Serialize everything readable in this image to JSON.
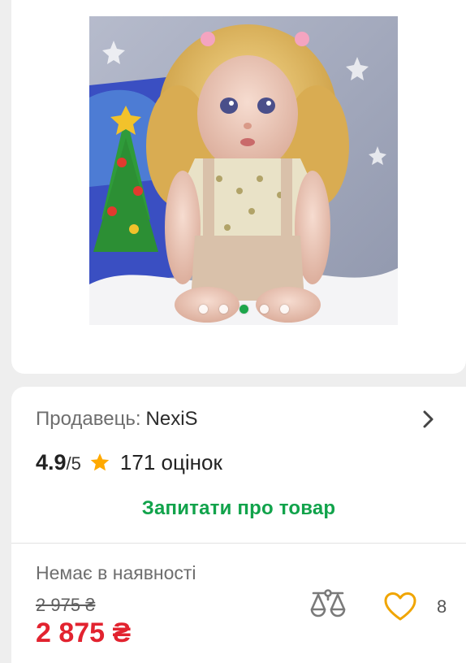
{
  "product": {
    "image_alt": "Doll with blonde curly hair",
    "gallery_count": 5,
    "gallery_active": 3
  },
  "seller": {
    "label": "Продавець:",
    "name": "NexiS"
  },
  "rating": {
    "value": "4.9",
    "max": "/5",
    "reviews": "171 оцінок"
  },
  "ask_link": "Запитати про товар",
  "availability": "Немає в наявності",
  "price": {
    "old": "2 975 ₴",
    "current": "2 875 ₴"
  },
  "favorites_count": "8",
  "colors": {
    "accent_green": "#11a34b",
    "price_red": "#e2232f",
    "star": "#ffa900"
  }
}
